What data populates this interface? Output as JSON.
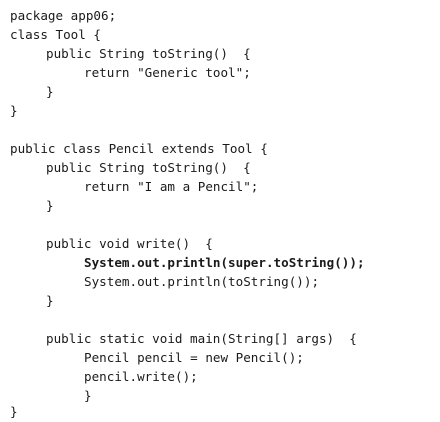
{
  "code_lines": [
    {
      "text": "package app06;"
    },
    {
      "text": "class Tool {"
    },
    {
      "text": "public String toString()  {"
    },
    {
      "text": "return \"Generic tool\";"
    },
    {
      "text": "}"
    },
    {
      "text": "}"
    },
    {
      "text": "public class Pencil extends Tool {"
    },
    {
      "text": "public String toString()  {"
    },
    {
      "text": "return \"I am a Pencil\";"
    },
    {
      "text": "}"
    },
    {
      "text": "public void write()  {"
    },
    {
      "text": "System.out.println(super.toString());"
    },
    {
      "text": "System.out.println(toString());"
    },
    {
      "text": "}"
    },
    {
      "text": "public static void main(String[] args)  {"
    },
    {
      "text": "Pencil pencil = new Pencil();"
    },
    {
      "text": "pencil.write();"
    },
    {
      "text": "}"
    },
    {
      "text": "}"
    }
  ]
}
